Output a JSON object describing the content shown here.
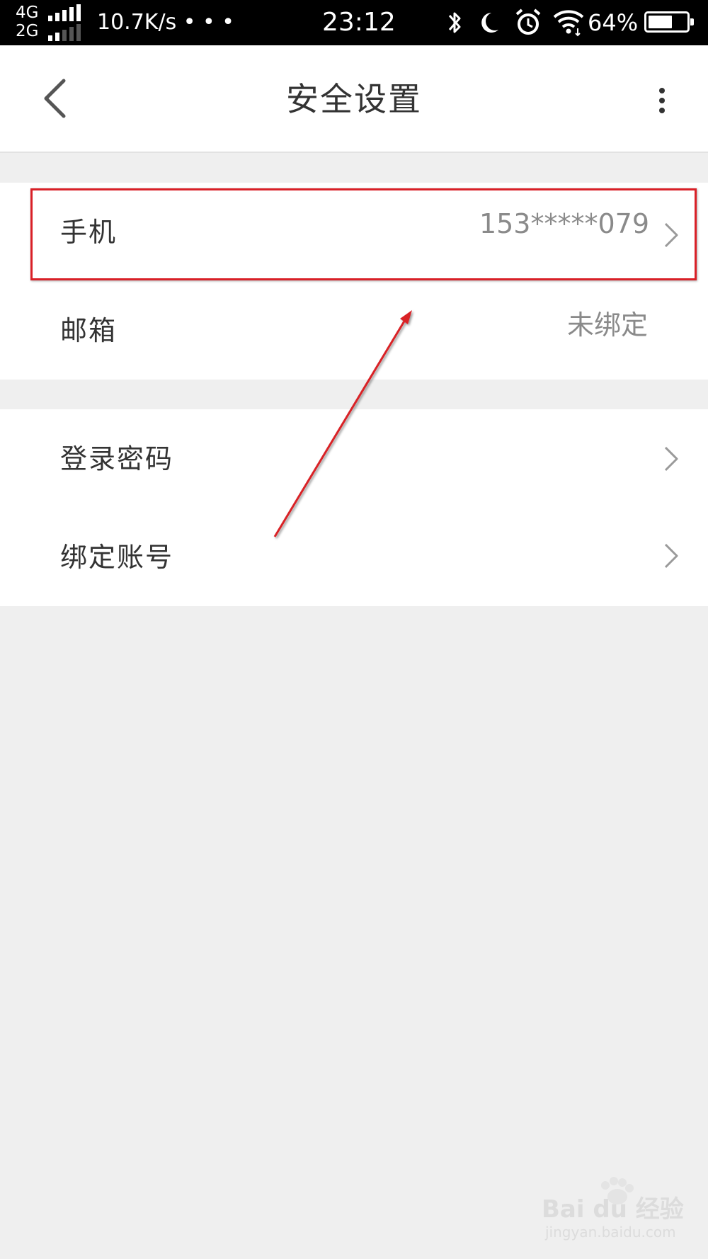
{
  "status_bar": {
    "network_primary": "4G",
    "network_secondary": "2G",
    "speed": "10.7K/s • • •",
    "time": "23:12",
    "battery_percent": "64%",
    "battery_level": 0.64,
    "icons": [
      "bluetooth-icon",
      "moon-icon",
      "alarm-icon",
      "wifi-icon",
      "battery-icon"
    ]
  },
  "header": {
    "title": "安全设置",
    "back_icon": "chevron-left-icon",
    "more_icon": "more-vertical-icon"
  },
  "groups": [
    {
      "rows": [
        {
          "label": "手机",
          "value": "153*****079",
          "chevron": true
        },
        {
          "label": "邮箱",
          "value": "未绑定",
          "chevron": false
        }
      ]
    },
    {
      "rows": [
        {
          "label": "登录密码",
          "value": "",
          "chevron": true
        },
        {
          "label": "绑定账号",
          "value": "",
          "chevron": true
        }
      ]
    }
  ],
  "annotation": {
    "highlight_color": "#d92027",
    "arrow_color": "#d92027"
  },
  "watermark": {
    "brand": "Bai du 经验",
    "url": "jingyan.baidu.com"
  }
}
